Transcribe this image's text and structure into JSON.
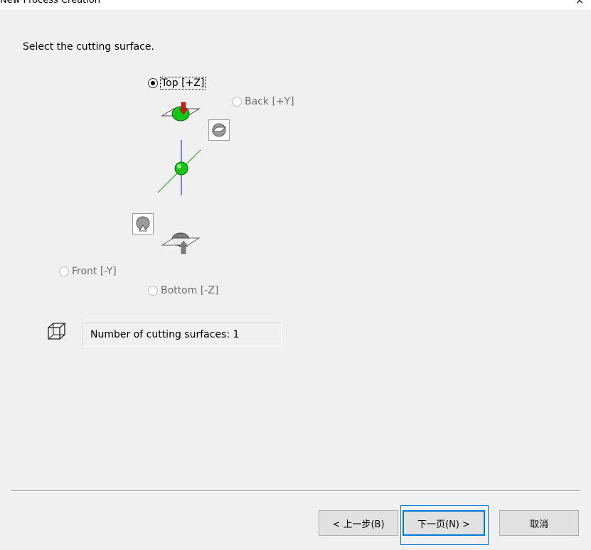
{
  "window": {
    "title": "New Process Creation",
    "close_icon": "close-icon"
  },
  "prompt": "Select the cutting surface.",
  "radios": {
    "top": {
      "label": "Top [+Z]",
      "checked": true,
      "enabled": true
    },
    "back": {
      "label": "Back [+Y]",
      "checked": false,
      "enabled": false
    },
    "front": {
      "label": "Front [-Y]",
      "checked": false,
      "enabled": false
    },
    "bottom": {
      "label": "Bottom [-Z]",
      "checked": false,
      "enabled": false
    }
  },
  "icons": {
    "top_surface": "top-surface-icon",
    "back_surface": "back-surface-icon",
    "axis": "axis-origin-icon",
    "front_surface": "front-surface-icon",
    "bottom_surface": "bottom-surface-icon",
    "count": "cube-icon"
  },
  "surface_count": {
    "text": "Number of cutting surfaces: 1"
  },
  "buttons": {
    "back": "< 上一步(B)",
    "next": "下一页(N) >",
    "cancel": "取消"
  },
  "colors": {
    "accent": "#0078d7",
    "sphere": "#19c419",
    "arrow": "#d11c1c",
    "axis_blue": "#2d35ff",
    "axis_green": "#3aa33a"
  }
}
